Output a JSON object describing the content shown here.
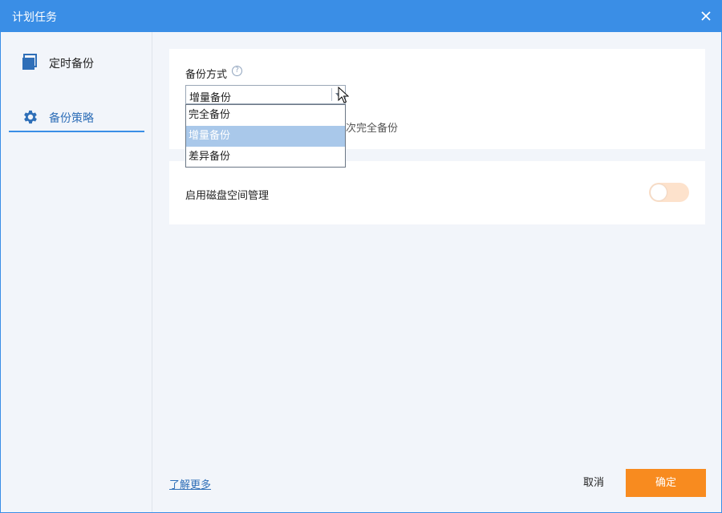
{
  "window": {
    "title": "计划任务",
    "close_glyph": "✕"
  },
  "sidebar": {
    "items": [
      {
        "label": "定时备份",
        "icon": "copy-icon"
      },
      {
        "label": "备份策略",
        "icon": "gear-icon",
        "active": true
      }
    ]
  },
  "backup_method": {
    "label": "备份方式",
    "help_glyph": "?",
    "selected": "增量备份",
    "behind_text": "次完全备份",
    "options": [
      "完全备份",
      "增量备份",
      "差异备份"
    ],
    "highlighted_index": 1
  },
  "disk_space": {
    "label": "启用磁盘空间管理",
    "enabled": false
  },
  "footer": {
    "learn_more": "了解更多",
    "cancel": "取消",
    "ok": "确定"
  },
  "colors": {
    "accent": "#3a8ee6",
    "ok_button": "#f88b1f",
    "toggle_off": "#fde2cc",
    "option_highlight": "#a9c8ea"
  }
}
